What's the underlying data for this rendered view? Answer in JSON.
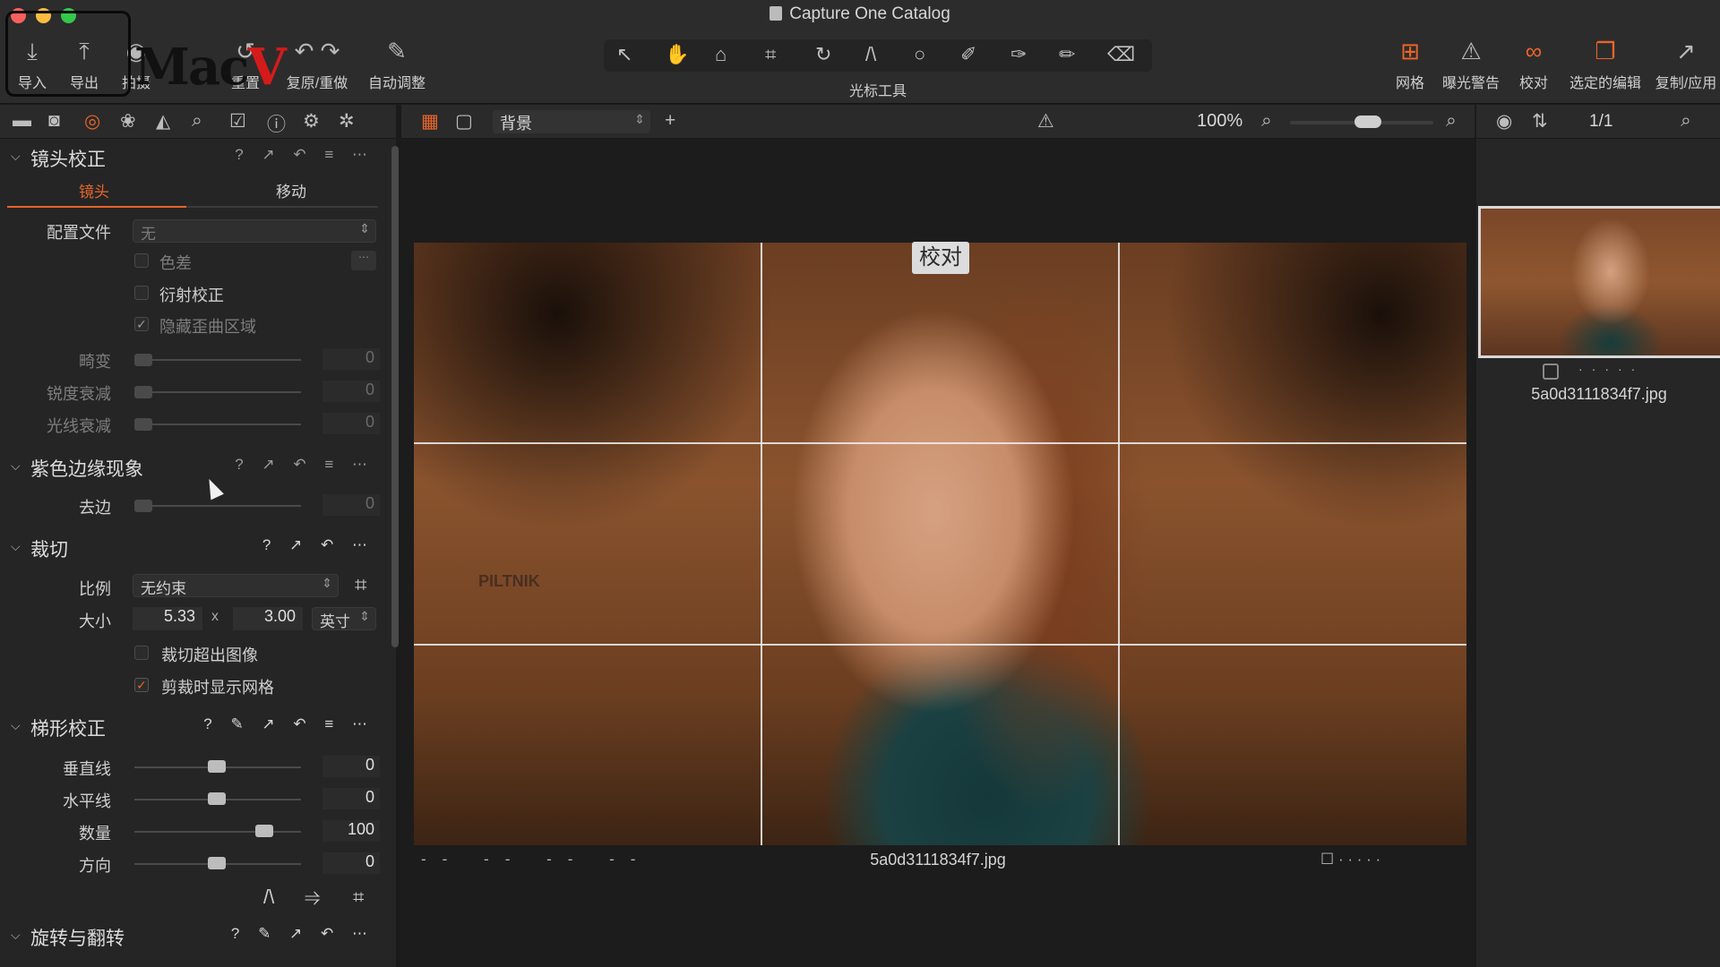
{
  "window": {
    "title": "Capture One Catalog"
  },
  "toolbar": {
    "left": [
      {
        "icon": "import-icon",
        "glyph": "⤓",
        "label": "导入"
      },
      {
        "icon": "export-icon",
        "glyph": "⤒",
        "label": "导出"
      },
      {
        "icon": "capture-icon",
        "glyph": "◉",
        "label": "拍摄"
      },
      {
        "icon": "reset-icon",
        "glyph": "↺",
        "label": "重置"
      },
      {
        "icon": "undo-redo-icon",
        "glyph": "↶ ↷",
        "label": "复原/重做"
      },
      {
        "icon": "auto-adjust-icon",
        "glyph": "✎",
        "label": "自动调整"
      }
    ],
    "cursor_tools_label": "光标工具",
    "cursor_tools": [
      {
        "icon": "select-icon",
        "glyph": "↖"
      },
      {
        "icon": "pan-hand-icon",
        "glyph": "✋"
      },
      {
        "icon": "loupe-icon",
        "glyph": "⌂"
      },
      {
        "icon": "crop-icon",
        "glyph": "⌗"
      },
      {
        "icon": "rotate-icon",
        "glyph": "↻"
      },
      {
        "icon": "keystone-icon",
        "glyph": "/\\"
      },
      {
        "icon": "spot-removal-icon",
        "glyph": "○"
      },
      {
        "icon": "brush-icon",
        "glyph": "✐"
      },
      {
        "icon": "color-picker-icon",
        "glyph": "✑"
      },
      {
        "icon": "gradient-icon",
        "glyph": "✏"
      },
      {
        "icon": "eraser-icon",
        "glyph": "⌫"
      }
    ],
    "right": [
      {
        "icon": "grid-icon",
        "glyph": "⊞",
        "label": "网格"
      },
      {
        "icon": "exposure-warning-icon",
        "glyph": "⚠",
        "label": "曝光警告"
      },
      {
        "icon": "proof-glasses-icon",
        "glyph": "∞",
        "label": "校对"
      },
      {
        "icon": "edit-selected-icon",
        "glyph": "❐",
        "label": "选定的编辑"
      },
      {
        "icon": "copy-apply-icon",
        "glyph": "↗",
        "label": "复制/应用"
      }
    ]
  },
  "brand_watermark": {
    "text_a": "Mac",
    "text_b": "V"
  },
  "left_panel": {
    "lens": {
      "title": "镜头校正",
      "tabs": [
        "镜头",
        "移动"
      ],
      "profile_label": "配置文件",
      "profile_value": "无",
      "checks": [
        {
          "label": "色差",
          "checked": false
        },
        {
          "label": "衍射校正",
          "checked": false
        },
        {
          "label": "隐藏歪曲区域",
          "checked": true
        }
      ],
      "sliders": [
        {
          "label": "畸变",
          "value": "0"
        },
        {
          "label": "锐度衰减",
          "value": "0"
        },
        {
          "label": "光线衰减",
          "value": "0"
        }
      ]
    },
    "fringe": {
      "title": "紫色边缘现象",
      "slider": {
        "label": "去边",
        "value": "0"
      }
    },
    "crop": {
      "title": "裁切",
      "ratio_label": "比例",
      "ratio_value": "无约束",
      "size_label": "大小",
      "width": "5.33",
      "times": "x",
      "height": "3.00",
      "unit": "英寸",
      "checks": [
        {
          "label": "裁切超出图像",
          "checked": false
        },
        {
          "label": "剪裁时显示网格",
          "checked": true
        }
      ]
    },
    "keystone": {
      "title": "梯形校正",
      "sliders": [
        {
          "label": "垂直线",
          "value": "0",
          "pos": 0.5
        },
        {
          "label": "水平线",
          "value": "0",
          "pos": 0.5
        },
        {
          "label": "数量",
          "value": "100",
          "pos": 0.8
        },
        {
          "label": "方向",
          "value": "0",
          "pos": 0.5
        }
      ]
    },
    "rotation": {
      "title": "旋转与翻转"
    }
  },
  "viewer": {
    "background_select": "背景",
    "zoom": "100%",
    "proof_badge": "校对",
    "photo_watermark": "PILTNIK",
    "filename": "5a0d3111834f7.jpg",
    "meta_placeholders": "-- -- -- --"
  },
  "browser": {
    "count": "1/1",
    "thumb_filename": "5a0d3111834f7.jpg"
  },
  "colors": {
    "accent": "#e8652a",
    "panel": "#252525",
    "toolbar": "#2c2c2c"
  }
}
